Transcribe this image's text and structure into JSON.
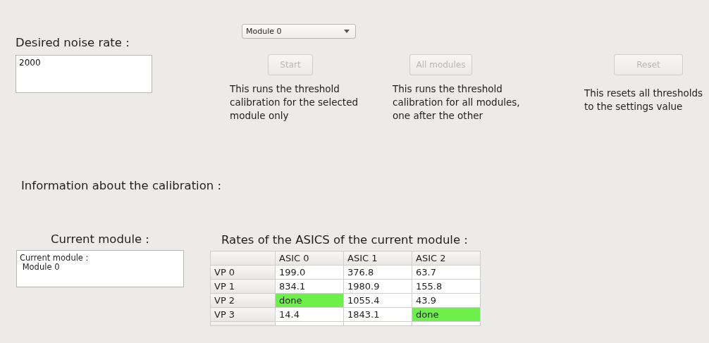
{
  "noise_rate": {
    "label": "Desired noise rate :",
    "value": "2000"
  },
  "module_select": {
    "value": "Module 0"
  },
  "actions": [
    {
      "button": "Start",
      "disabled": true,
      "description": "This runs the threshold calibration for the selected module only"
    },
    {
      "button": "All modules",
      "disabled": true,
      "description": "This runs the threshold calibration for all modules, one after the other"
    },
    {
      "button": "Reset",
      "disabled": true,
      "description": "This resets all thresholds to the settings value"
    }
  ],
  "info_title": "Information about the calibration :",
  "current_module": {
    "label": "Current module :",
    "lines": [
      "Current module :",
      " Module 0"
    ]
  },
  "rates": {
    "title": "Rates of the ASICS of the current module :",
    "columns": [
      "ASIC 0",
      "ASIC 1",
      "ASIC 2"
    ],
    "rows": [
      {
        "header": "VP 0",
        "cells": [
          {
            "text": "199.0",
            "highlighted": false
          },
          {
            "text": "376.8",
            "highlighted": false
          },
          {
            "text": "63.7",
            "highlighted": false
          }
        ]
      },
      {
        "header": "VP 1",
        "cells": [
          {
            "text": "834.1",
            "highlighted": false
          },
          {
            "text": "1980.9",
            "highlighted": false
          },
          {
            "text": "155.8",
            "highlighted": false
          }
        ]
      },
      {
        "header": "VP 2",
        "cells": [
          {
            "text": "done",
            "highlighted": true
          },
          {
            "text": "1055.4",
            "highlighted": false
          },
          {
            "text": "43.9",
            "highlighted": false
          }
        ]
      },
      {
        "header": "VP 3",
        "cells": [
          {
            "text": "14.4",
            "highlighted": false
          },
          {
            "text": "1843.1",
            "highlighted": false
          },
          {
            "text": "done",
            "highlighted": true
          }
        ]
      }
    ]
  }
}
